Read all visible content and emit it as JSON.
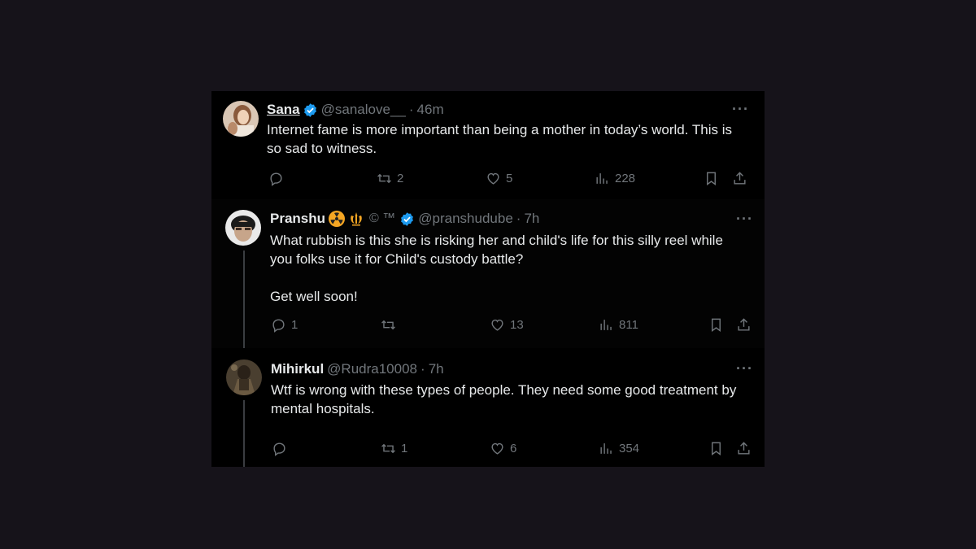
{
  "tweets": [
    {
      "name": "Sana",
      "handle": "@sanalove__",
      "time": "46m",
      "text": "Internet fame is more important than being a mother in today’s world. This is so sad to witness.",
      "replies": "",
      "retweets": "2",
      "likes": "5",
      "views": "228"
    },
    {
      "name": "Pranshu",
      "badges": "© ™",
      "handle": "@pranshudube",
      "time": "7h",
      "text": "What rubbish is this she is risking her and child's life for this silly reel while you folks use it for Child's custody battle?\n\nGet well soon!",
      "replies": "1",
      "retweets": "",
      "likes": "13",
      "views": "811"
    },
    {
      "name": "Mihirkul",
      "handle": "@Rudra10008",
      "time": "7h",
      "text": "Wtf is wrong with these types of people. They need some good treatment by mental hospitals.",
      "replies": "",
      "retweets": "1",
      "likes": "6",
      "views": "354"
    }
  ],
  "ui": {
    "separator": "·",
    "more": "···"
  },
  "colors": {
    "background": "#16131a",
    "verified": "#1d9bf0",
    "muted": "#71767b"
  }
}
